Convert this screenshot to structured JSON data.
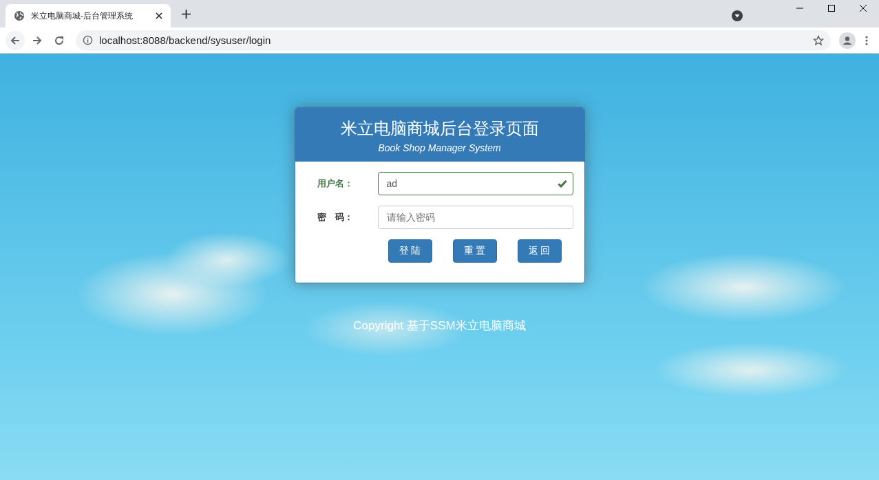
{
  "browser": {
    "tab": {
      "title": "米立电脑商城-后台管理系统",
      "selected": true
    },
    "url": "localhost:8088/backend/sysuser/login"
  },
  "login": {
    "title": "米立电脑商城后台登录页面",
    "subtitle": "Book Shop Manager System",
    "fields": [
      {
        "label": "用户名：",
        "value": "ad",
        "valid": true
      },
      {
        "label": "密　码：",
        "placeholder": "请输入密码",
        "valid": false
      }
    ],
    "buttons": [
      "登 陆",
      "重 置",
      "返 回"
    ]
  },
  "footer": "Copyright 基于SSM米立电脑商城"
}
